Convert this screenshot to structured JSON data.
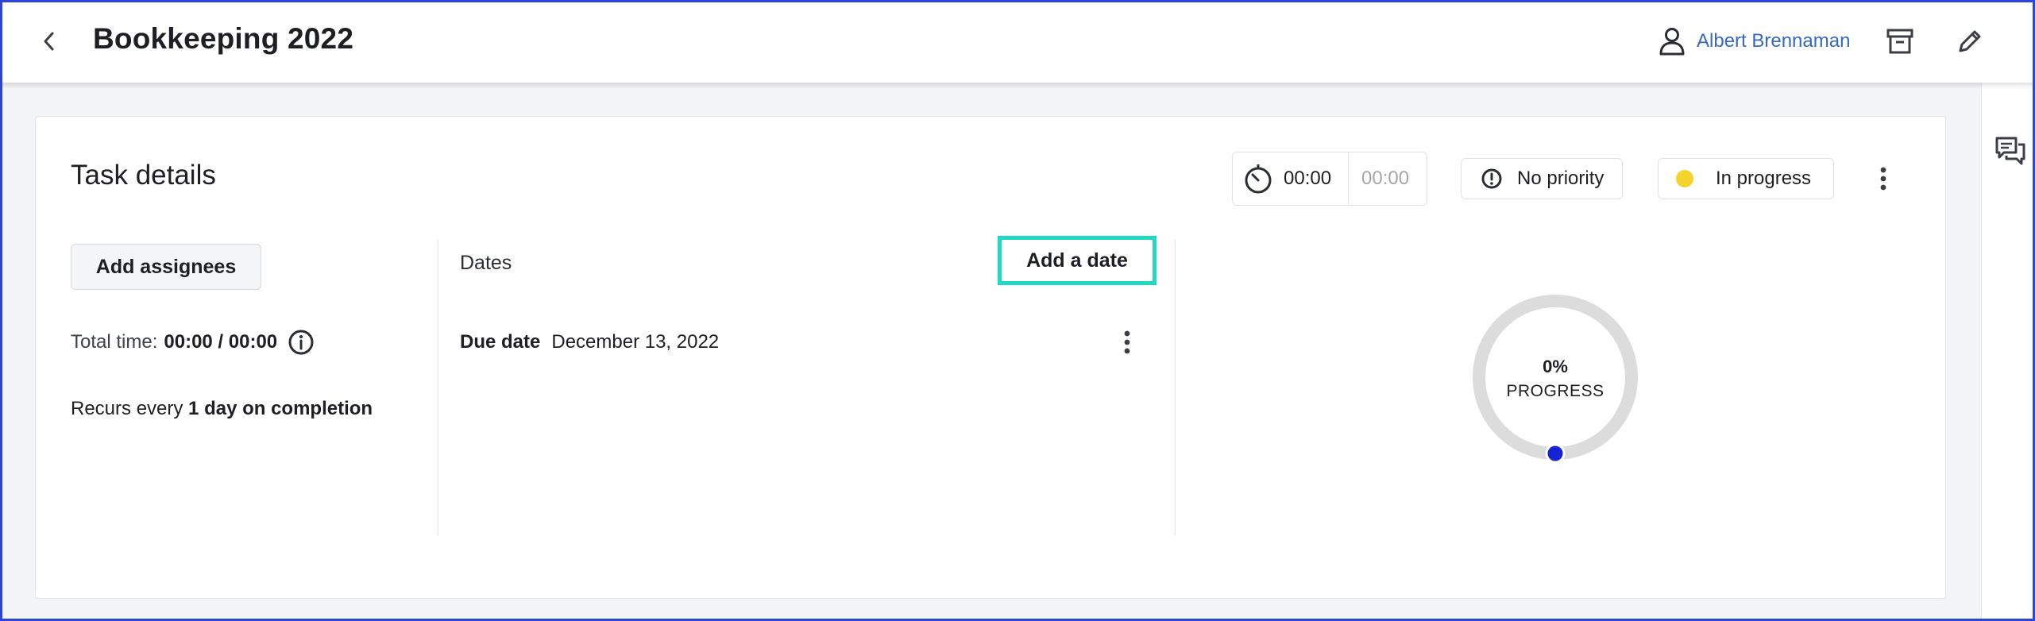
{
  "header": {
    "title": "Bookkeeping 2022",
    "user_name": "Albert Brennaman",
    "back_icon": "chevron-left-icon",
    "user_icon": "user-icon",
    "archive_icon": "archive-icon",
    "edit_icon": "pencil-icon"
  },
  "task": {
    "title": "Task details",
    "timer": {
      "tracked": "00:00",
      "estimate": "00:00"
    },
    "priority": {
      "label": "No priority",
      "icon": "alert-circle-icon"
    },
    "status": {
      "label": "In progress",
      "color": "#f3d42c"
    },
    "add_assignees_label": "Add assignees",
    "total_time_label": "Total time:",
    "total_time_value": "00:00 / 00:00",
    "recurs_prefix": "Recurs every",
    "recurs_value": "1 day on completion"
  },
  "dates": {
    "label": "Dates",
    "add_date_label": "Add a date",
    "due_label": "Due date",
    "due_value": "December 13, 2022"
  },
  "progress": {
    "percent": 0,
    "percent_text": "0%",
    "label": "PROGRESS",
    "track_color": "#dcdcdc",
    "handle_color": "#1522d6"
  },
  "colors": {
    "accent_link": "#3569c2",
    "focus_outline": "#1fd9c2",
    "frame": "#2b45d8"
  },
  "rail": {
    "comments_icon": "comments-icon"
  }
}
